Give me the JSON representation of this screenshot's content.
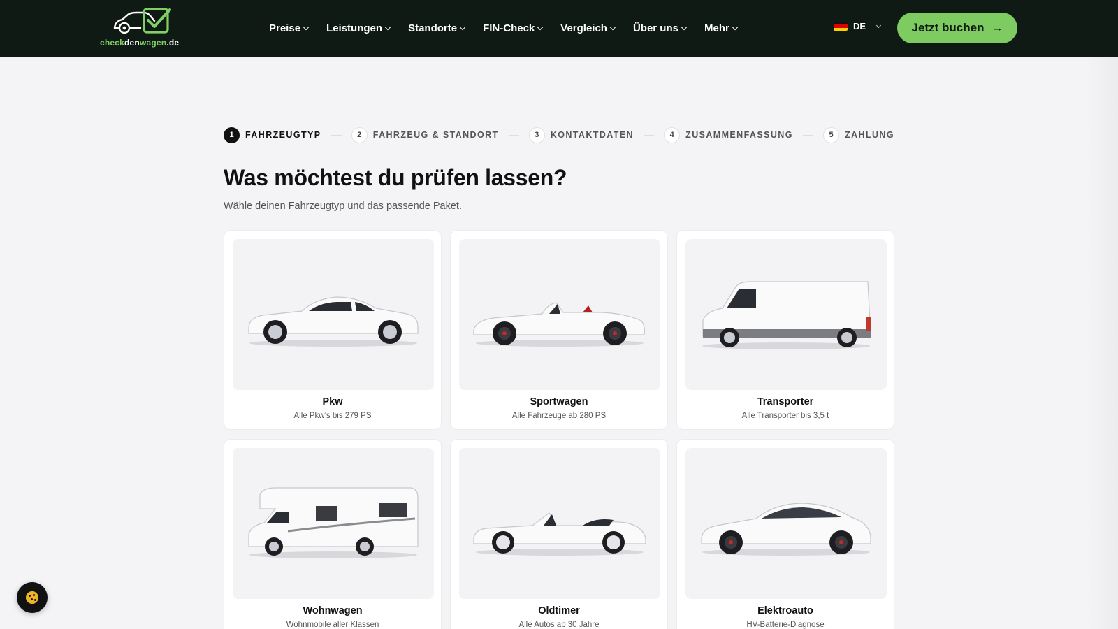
{
  "header": {
    "logo": {
      "part1": "check",
      "part2": "den",
      "part3": "wagen",
      "part4": ".de"
    },
    "nav": [
      {
        "label": "Preise"
      },
      {
        "label": "Leistungen"
      },
      {
        "label": "Standorte"
      },
      {
        "label": "FIN-Check"
      },
      {
        "label": "Vergleich"
      },
      {
        "label": "Über uns"
      },
      {
        "label": "Mehr"
      }
    ],
    "language": "DE",
    "cta_label": "Jetzt buchen",
    "cta_icon": "arrow-right-icon"
  },
  "stepper": [
    {
      "num": "1",
      "label": "FAHRZEUGTYP",
      "active": true
    },
    {
      "num": "2",
      "label": "FAHRZEUG & STANDORT",
      "active": false
    },
    {
      "num": "3",
      "label": "KONTAKTDATEN",
      "active": false
    },
    {
      "num": "4",
      "label": "ZUSAMMENFASSUNG",
      "active": false
    },
    {
      "num": "5",
      "label": "ZAHLUNG",
      "active": false
    }
  ],
  "main": {
    "title": "Was möchtest du prüfen lassen?",
    "subtitle": "Wähle deinen Fahrzeugtyp und das passende Paket."
  },
  "vehicles": [
    {
      "name": "Pkw",
      "desc": "Alle Pkw’s bis 279 PS",
      "icon": "sedan-image"
    },
    {
      "name": "Sportwagen",
      "desc": "Alle Fahrzeuge ab 280 PS",
      "icon": "roadster-image"
    },
    {
      "name": "Transporter",
      "desc": "Alle Transporter bis 3,5 t",
      "icon": "van-image"
    },
    {
      "name": "Wohnwagen",
      "desc": "Wohnmobile aller Klassen",
      "icon": "motorhome-image"
    },
    {
      "name": "Oldtimer",
      "desc": "Alle Autos ab 30 Jahre",
      "icon": "classic-car-image"
    },
    {
      "name": "Elektroauto",
      "desc": "HV-Batterie-Diagnose",
      "icon": "electric-car-image"
    }
  ],
  "colors": {
    "header_bg": "#0f1a15",
    "accent": "#7ecb62",
    "page_bg": "#f4f4f6"
  },
  "cookie_icon": "cookie-icon"
}
